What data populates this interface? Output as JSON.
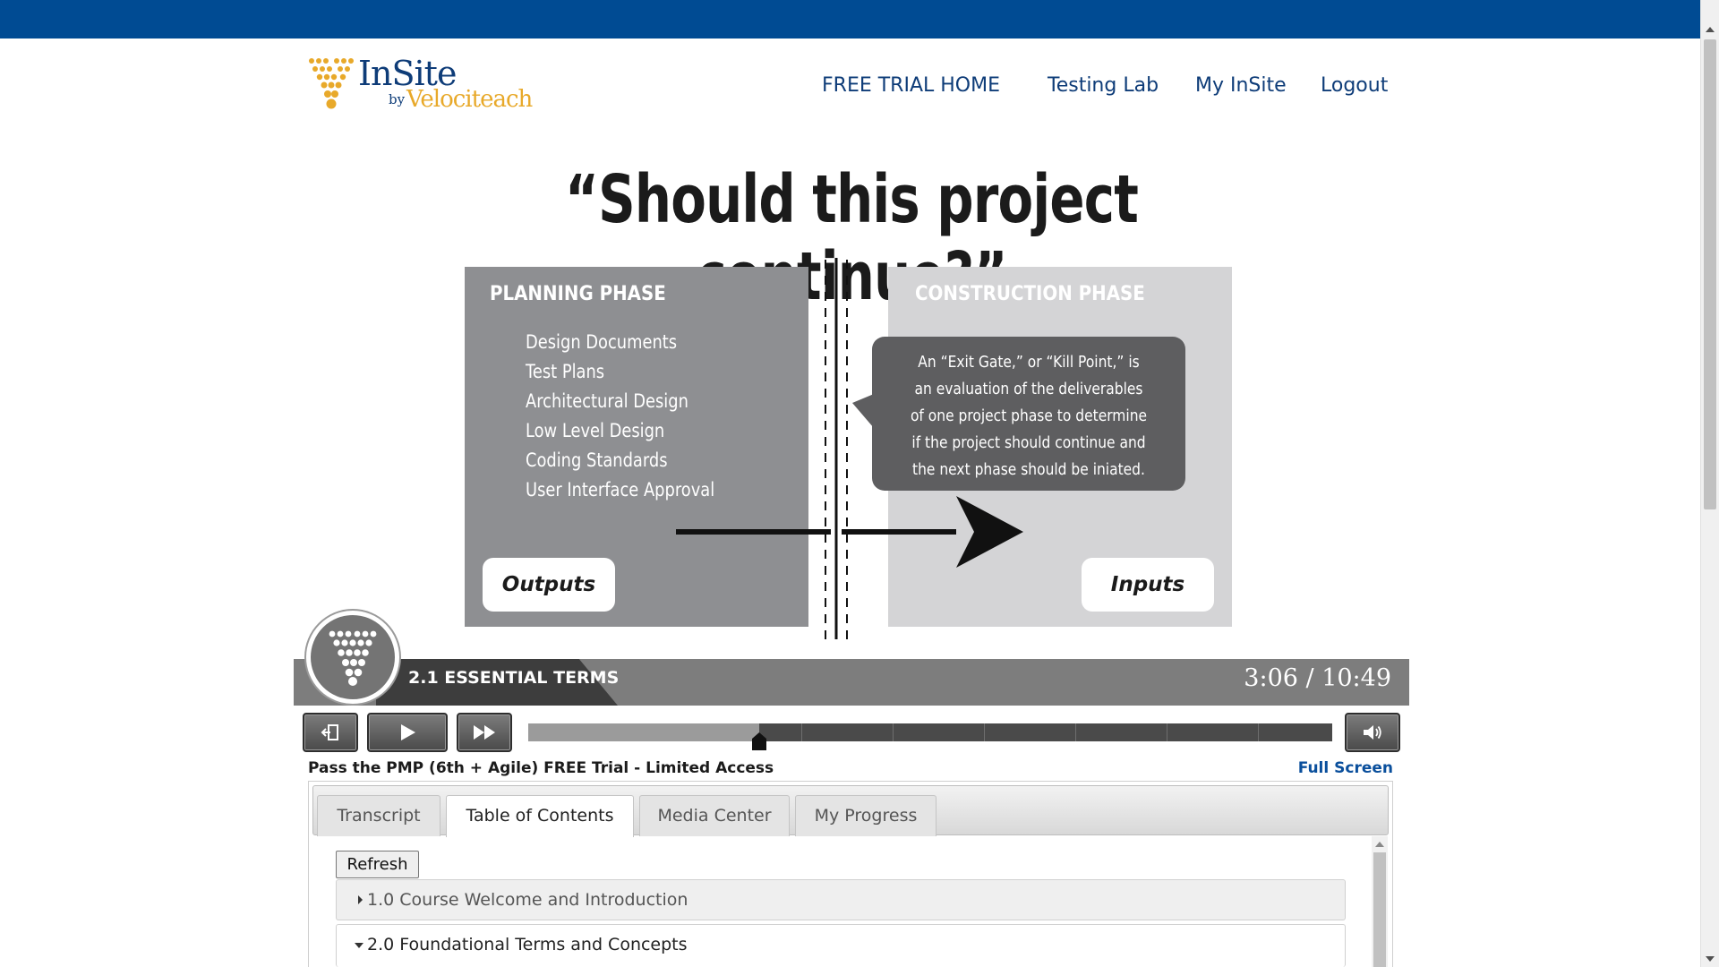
{
  "brand": {
    "name": "InSite",
    "by": "by",
    "company": "Velociteach",
    "colors": {
      "topbar": "#004b93",
      "nav": "#0e3c78",
      "gold": "#e8a92a"
    }
  },
  "nav": {
    "items": [
      {
        "label": "FREE TRIAL HOME"
      },
      {
        "label": "Testing Lab"
      },
      {
        "label": "My InSite"
      },
      {
        "label": "Logout"
      }
    ]
  },
  "slide": {
    "title": "“Should this project continue?”",
    "left_panel": {
      "heading": "PLANNING PHASE",
      "items": [
        "Design Documents",
        "Test Plans",
        "Architectural Design",
        "Low Level Design",
        "Coding Standards",
        "User Interface Approval"
      ],
      "pill": "Outputs"
    },
    "right_panel": {
      "heading": "CONSTRUCTION PHASE",
      "pill": "Inputs"
    },
    "callout": "An “Exit Gate,” or “Kill Point,” is an evaluation of the deliverables of one project phase to determine if the project should continue and the next phase should be iniated."
  },
  "player": {
    "lesson": "2.1 ESSENTIAL TERMS",
    "time": "3:06 / 10:49",
    "progress_fraction": 0.287,
    "buttons": {
      "exit_icon": "exit-icon",
      "play_icon": "play-icon",
      "forward_icon": "fast-forward-icon",
      "volume_icon": "volume-icon"
    }
  },
  "course": {
    "title": "Pass the PMP (6th + Agile) FREE Trial - Limited Access",
    "fullscreen": "Full Screen"
  },
  "tabs": {
    "items": [
      {
        "label": "Transcript"
      },
      {
        "label": "Table of Contents"
      },
      {
        "label": "Media Center"
      },
      {
        "label": "My Progress"
      }
    ],
    "active": "Table of Contents"
  },
  "toc": {
    "refresh_label": "Refresh",
    "sections": [
      {
        "label": "1.0 Course Welcome and Introduction",
        "expanded": false
      },
      {
        "label": "2.0 Foundational Terms and Concepts",
        "expanded": true
      }
    ]
  }
}
